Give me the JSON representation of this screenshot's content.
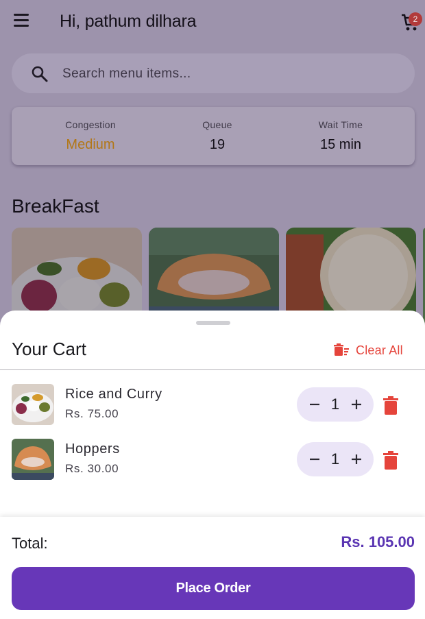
{
  "header": {
    "greeting": "Hi, pathum dilhara",
    "cart_badge": "2",
    "icons": {
      "menu": "menu-icon",
      "cart": "cart-icon"
    }
  },
  "search": {
    "placeholder": "Search menu items...",
    "value": "",
    "icon": "search-icon"
  },
  "stats": {
    "congestion": {
      "label": "Congestion",
      "value": "Medium",
      "color": "#b27717"
    },
    "queue": {
      "label": "Queue",
      "value": "19"
    },
    "wait_time": {
      "label": "Wait Time",
      "value": "15 min"
    }
  },
  "section": {
    "title": "BreakFast"
  },
  "cart": {
    "title": "Your Cart",
    "clear_all": "Clear All",
    "items": [
      {
        "name": "Rice and Curry",
        "price": "Rs. 75.00",
        "qty": "1"
      },
      {
        "name": "Hoppers",
        "price": "Rs. 30.00",
        "qty": "1"
      }
    ],
    "total_label": "Total:",
    "total_value": "Rs. 105.00",
    "place_order": "Place Order"
  },
  "colors": {
    "accent": "#6737b8",
    "danger": "#e5443b",
    "stepper_bg": "#ebe5f7"
  }
}
